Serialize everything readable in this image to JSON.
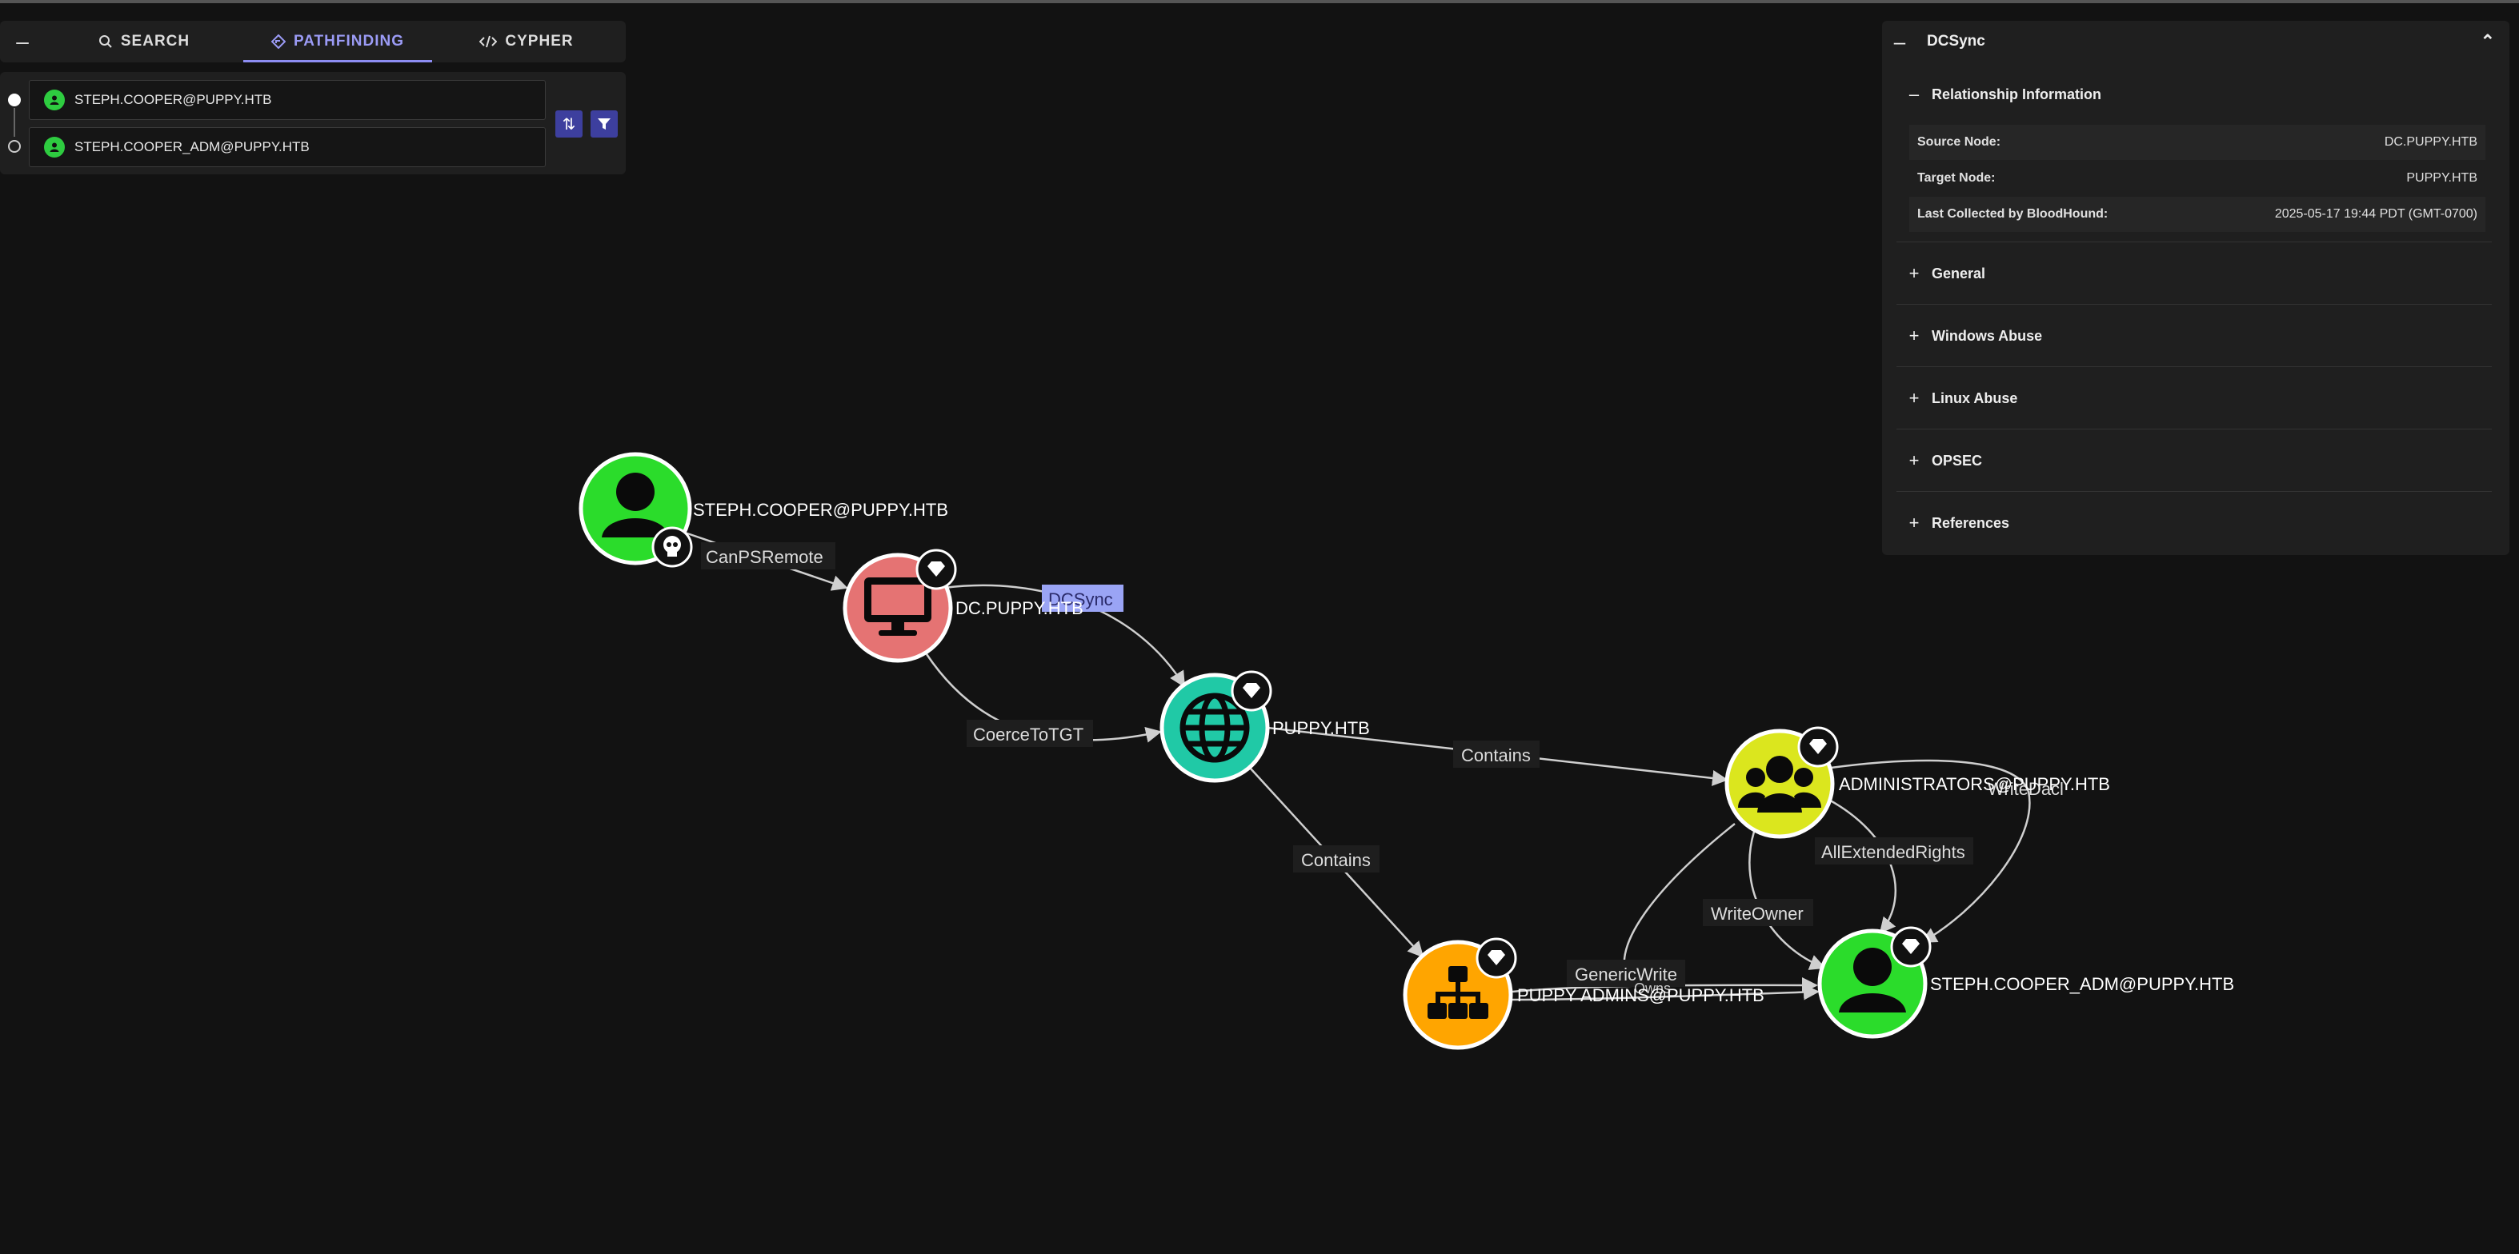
{
  "tabs": {
    "collapse_icon": "minus-icon",
    "search": "SEARCH",
    "pathfinding": "PATHFINDING",
    "cypher": "CYPHER"
  },
  "pathfinding": {
    "source": "STEPH.COOPER@PUPPY.HTB",
    "target": "STEPH.COOPER_ADM@PUPPY.HTB"
  },
  "info_panel": {
    "title": "DCSync",
    "relationship_header": "Relationship Information",
    "rows": [
      {
        "key": "Source Node:",
        "value": "DC.PUPPY.HTB"
      },
      {
        "key": "Target Node:",
        "value": "PUPPY.HTB"
      },
      {
        "key": "Last Collected by BloodHound:",
        "value": "2025-05-17 19:44 PDT (GMT-0700)"
      }
    ],
    "sections": [
      "General",
      "Windows Abuse",
      "Linux Abuse",
      "OPSEC",
      "References"
    ]
  },
  "graph": {
    "nodes": {
      "steph": "STEPH.COOPER@PUPPY.HTB",
      "dc": "DC.PUPPY.HTB",
      "domain": "PUPPY.HTB",
      "admins_group": "ADMINISTRATORS@PUPPY.HTB",
      "ou": "PUPPY ADMINS@PUPPY.HTB",
      "steph_adm": "STEPH.COOPER_ADM@PUPPY.HTB"
    },
    "edges": {
      "canpsremote": "CanPSRemote",
      "dcsync": "DCSync",
      "coercetotgt": "CoerceToTGT",
      "contains1": "Contains",
      "contains2": "Contains",
      "allextendedrights": "AllExtendedRights",
      "writedacl": "WriteDacl",
      "writeowner": "WriteOwner",
      "genericwrite": "GenericWrite",
      "owns": "Owns"
    }
  },
  "colors": {
    "accent": "#8d8df2",
    "user_node": "#2bdc2b",
    "computer_node": "#e57373",
    "domain_node": "#20c9a6",
    "group_node": "#dbe61e",
    "ou_node": "#ffa500",
    "selected_edge_label": "#9aa4f5"
  }
}
